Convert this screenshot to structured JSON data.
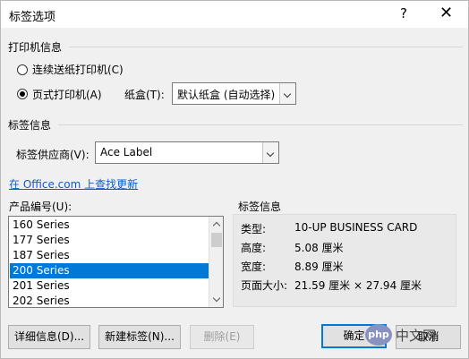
{
  "dialog": {
    "title": "标签选项",
    "help_label": "?",
    "close_label": "✕"
  },
  "printer_info": {
    "heading": "打印机信息",
    "continuous_label": "连续送纸打印机(C)",
    "page_label": "页式打印机(A)",
    "selected": "page",
    "tray_label": "纸盒(T):",
    "tray_value": "默认纸盒 (自动选择)"
  },
  "label_info": {
    "heading": "标签信息",
    "vendor_label": "标签供应商(V):",
    "vendor_value": "Ace Label",
    "update_link": "在 Office.com 上查找更新"
  },
  "product": {
    "heading": "产品编号(U):",
    "items": [
      "160 Series",
      "177 Series",
      "187 Series",
      "200 Series",
      "201 Series",
      "202 Series"
    ],
    "selected_index": 3
  },
  "details": {
    "heading": "标签信息",
    "rows": [
      {
        "key": "类型:",
        "value": "10-UP BUSINESS CARD"
      },
      {
        "key": "高度:",
        "value": "5.08 厘米"
      },
      {
        "key": "宽度:",
        "value": "8.89 厘米"
      },
      {
        "key": "页面大小:",
        "value": "21.59 厘米 × 27.94 厘米"
      }
    ]
  },
  "buttons": {
    "details": "详细信息(D)...",
    "new_label": "新建标签(N)...",
    "delete": "删除(E)",
    "ok": "确定",
    "cancel": "取消"
  },
  "watermark": {
    "logo": "php",
    "text": "中文网"
  },
  "colors": {
    "selection": "#0078d7",
    "link": "#0b5bd0",
    "default_button_border": "#0078d7"
  }
}
